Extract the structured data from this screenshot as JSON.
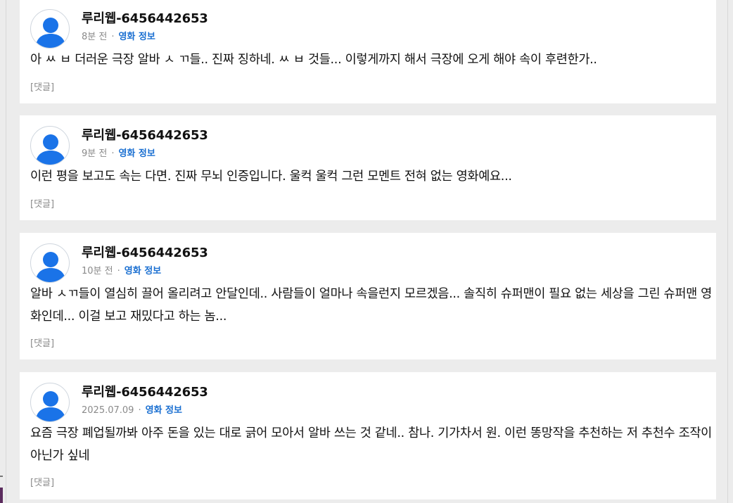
{
  "comments": [
    {
      "author": "루리웹-6456442653",
      "time": "8분 전",
      "category": "영화 정보",
      "text": "아 ㅆ ㅂ 더러운 극장 알바 ㅅ ㄲ들.. 진짜 징하네. ㅆ ㅂ 것들... 이렇게까지 해서 극장에 오게 해야 속이 후련한가..",
      "reply": "[댓글]"
    },
    {
      "author": "루리웹-6456442653",
      "time": "9분 전",
      "category": "영화 정보",
      "text": "이런 평을 보고도 속는 다면. 진짜 무뇌 인증입니다. 울컥 울컥 그런 모멘트 전혀 없는 영화예요...",
      "reply": "[댓글]"
    },
    {
      "author": "루리웹-6456442653",
      "time": "10분 전",
      "category": "영화 정보",
      "text": "알바 ㅅㄲ들이 열심히 끌어 올리려고 안달인데.. 사람들이 얼마나 속을런지 모르겠음... 솔직히 슈퍼맨이 필요 없는 세상을 그린 슈퍼맨 영화인데... 이걸 보고 재밌다고 하는 놈...",
      "reply": "[댓글]"
    },
    {
      "author": "루리웹-6456442653",
      "time": "2025.07.09",
      "category": "영화 정보",
      "text": "요즘 극장 폐업될까봐 아주 돈을 있는 대로 긁어 모아서 알바 쓰는 것 같네.. 참나. 기가차서 원. 이런 똥망작을 추천하는 저 추천수 조작이 아닌가 싶네",
      "reply": "[댓글]"
    }
  ],
  "avatar_icon": "user-avatar-icon",
  "colors": {
    "background": "#ececec",
    "card": "#ffffff",
    "category": "#1a6fd1",
    "avatar": "#1a73e8",
    "meta": "#8a8a8a"
  }
}
